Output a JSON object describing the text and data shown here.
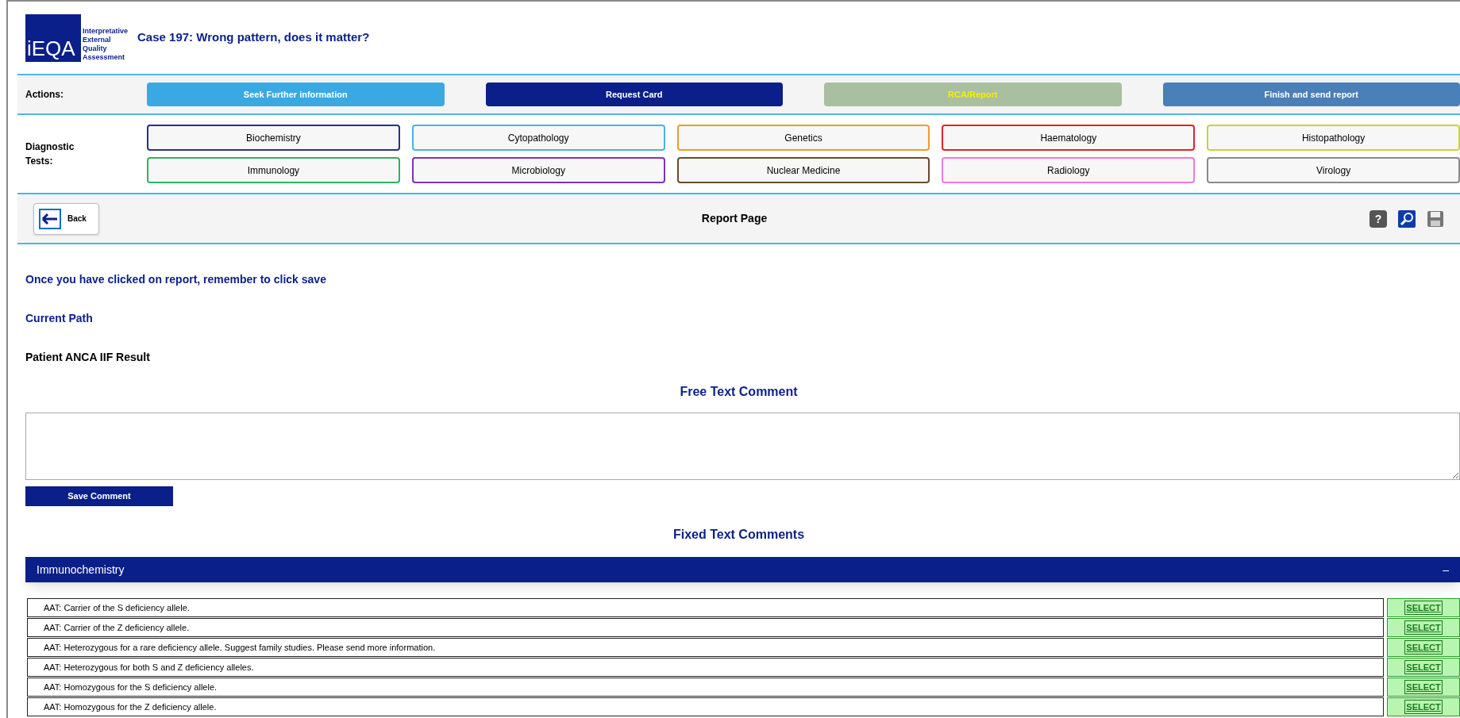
{
  "header": {
    "logo_mark": "iEQA",
    "logo_text": [
      "Interpretative",
      "External",
      "Quality",
      "Assessment"
    ],
    "title": "Case 197: Wrong pattern, does it matter?"
  },
  "actions": {
    "label": "Actions:",
    "buttons": [
      {
        "label": "Seek Further information",
        "color": "#3aa9e3",
        "disabled": false
      },
      {
        "label": "Request Card",
        "color": "#0b1f8a",
        "disabled": false
      },
      {
        "label": "RCA/Report",
        "color": "#a9bfa0",
        "disabled": true
      },
      {
        "label": "Finish and send report",
        "color": "#4a7fb8",
        "disabled": false
      }
    ]
  },
  "diagnostic_tests": {
    "label": "Diagnostic Tests:",
    "items": [
      {
        "label": "Biochemistry",
        "color": "#2c2f8a"
      },
      {
        "label": "Cytopathology",
        "color": "#47b4e6"
      },
      {
        "label": "Genetics",
        "color": "#f29a2e"
      },
      {
        "label": "Haematology",
        "color": "#d9262b"
      },
      {
        "label": "Histopathology",
        "color": "#c9d33a"
      },
      {
        "label": "Immunology",
        "color": "#2bb463"
      },
      {
        "label": "Microbiology",
        "color": "#7a35b8"
      },
      {
        "label": "Nuclear Medicine",
        "color": "#6b4a2e"
      },
      {
        "label": "Radiology",
        "color": "#f07ae0"
      },
      {
        "label": "Virology",
        "color": "#8a8a8a"
      }
    ]
  },
  "toolbar": {
    "back": "Back",
    "title": "Report Page",
    "help_icon": "?"
  },
  "instructions": "Once you have clicked on report, remember to click save",
  "current_path": "Current Path",
  "patient_result": "Patient ANCA IIF Result",
  "free_text_heading": "Free Text Comment",
  "save_comment": "Save Comment",
  "fixed_text_heading": "Fixed Text Comments",
  "section": {
    "title": "Immunochemistry",
    "toggle": "–",
    "rows": [
      {
        "text": "AAT: Carrier of the S deficiency allele.",
        "action": "SELECT"
      },
      {
        "text": "AAT: Carrier of the Z deficiency allele.",
        "action": "SELECT"
      },
      {
        "text": "AAT: Heterozygous for a rare deficiency allele. Suggest family studies. Please send more information.",
        "action": "SELECT"
      },
      {
        "text": "AAT: Heterozygous for both S and Z deficiency alleles.",
        "action": "SELECT"
      },
      {
        "text": "AAT: Homozygous for the S deficiency allele.",
        "action": "SELECT"
      },
      {
        "text": "AAT: Homozygous for the Z deficiency allele.",
        "action": "SELECT"
      }
    ]
  }
}
